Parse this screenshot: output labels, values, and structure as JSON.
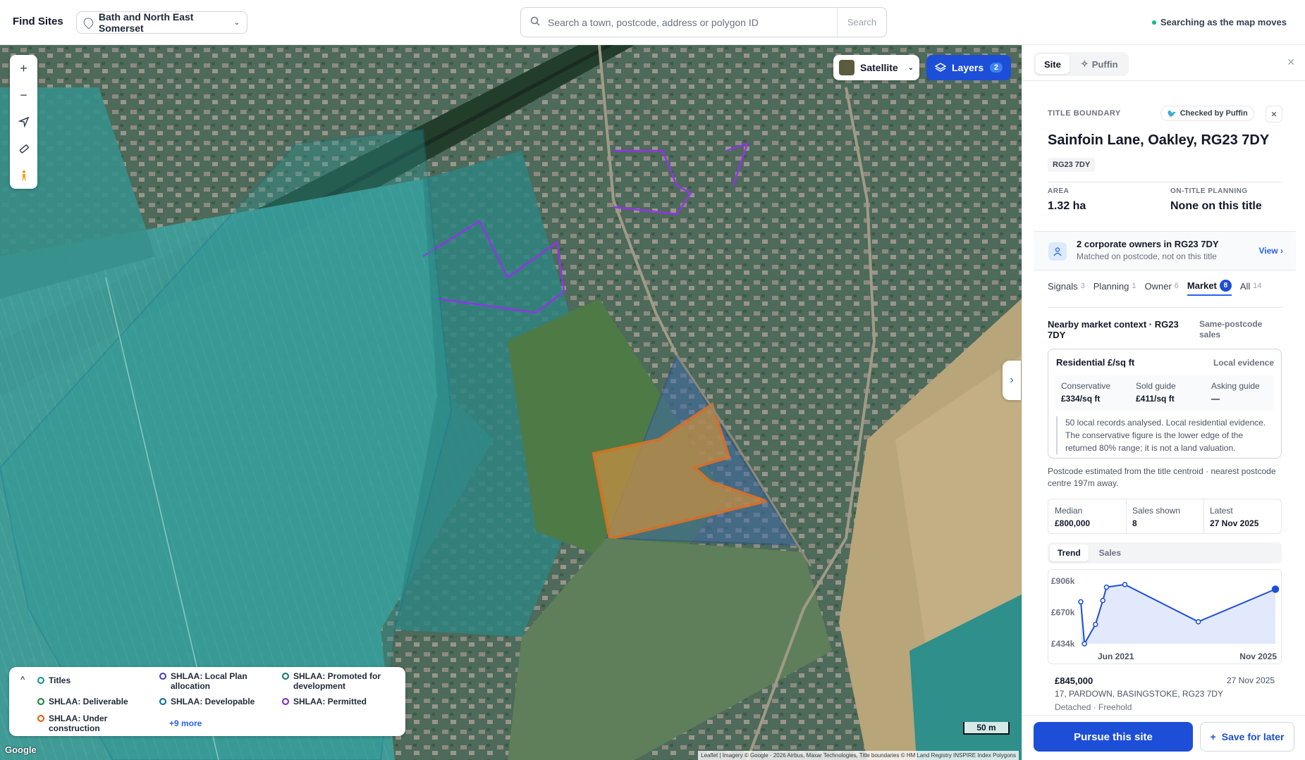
{
  "header": {
    "brand": "Find Sites",
    "region": "Bath and North East Somerset",
    "search_placeholder": "Search a town, postcode, address or polygon ID",
    "search_button": "Search",
    "status": "Searching as the map moves"
  },
  "map": {
    "basemap_label": "Satellite",
    "layers_label": "Layers",
    "layers_count": "2",
    "scale_label": "50 m",
    "provider": "Google",
    "attribution": "Leaflet | Imagery © Google · 2026 Airbus, Maxar Technologies, Title boundaries © HM Land Registry INSPIRE Index Polygons",
    "tools": [
      "zoom-in",
      "zoom-out",
      "locate",
      "measure",
      "street-view"
    ]
  },
  "legend": {
    "items": [
      {
        "label": "Titles",
        "color": "#0d9488"
      },
      {
        "label": "SHLAA: Local Plan allocation",
        "color": "#4338ca"
      },
      {
        "label": "SHLAA: Promoted for development",
        "color": "#0f766e"
      },
      {
        "label": "SHLAA: Deliverable",
        "color": "#15803d"
      },
      {
        "label": "SHLAA: Developable",
        "color": "#0369a1"
      },
      {
        "label": "SHLAA: Permitted",
        "color": "#7e22ce"
      },
      {
        "label": "SHLAA: Under construction",
        "color": "#ea580c"
      }
    ],
    "more": "+9 more"
  },
  "panel": {
    "tabs": [
      "Site",
      "Puffin"
    ],
    "section_label": "TITLE BOUNDARY",
    "checked_label": "Checked by Puffin",
    "title": "Sainfoin Lane, Oakley, RG23 7DY",
    "postcode_chip": "RG23 7DY",
    "area_label": "AREA",
    "area_value": "1.32 ha",
    "planning_label": "ON-TITLE PLANNING",
    "planning_value": "None on this title",
    "owners_title": "2 corporate owners in RG23 7DY",
    "owners_sub": "Matched on postcode, not on this title",
    "owners_view": "View",
    "signal_tabs": [
      {
        "label": "Signals",
        "count": "3"
      },
      {
        "label": "Planning",
        "count": "1"
      },
      {
        "label": "Owner",
        "count": "6"
      },
      {
        "label": "Market",
        "count": "8"
      },
      {
        "label": "All",
        "count": "14"
      }
    ],
    "market_title": "Nearby market context · RG23 7DY",
    "market_side": "Same-postcode sales",
    "res_title": "Residential £/sq ft",
    "res_badge": "Local evidence",
    "conservative_label": "Conservative",
    "conservative_value": "£334/sq ft",
    "sold_label": "Sold guide",
    "sold_value": "£411/sq ft",
    "asking_label": "Asking guide",
    "asking_value": "—",
    "res_note": "50 local records analysed. Local residential evidence. The conservative figure is the lower edge of the returned 80% range; it is not a land valuation.",
    "postcode_note": "Postcode estimated from the title centroid · nearest postcode centre 197m away.",
    "median_label": "Median",
    "median_value": "£800,000",
    "shown_label": "Sales shown",
    "shown_value": "8",
    "latest_label": "Latest",
    "latest_value": "27 Nov 2025",
    "chart_tabs": [
      "Trend",
      "Sales"
    ],
    "sale_price": "£845,000",
    "sale_date": "27 Nov 2025",
    "sale_addr": "17, PARDOWN, BASINGSTOKE, RG23 7DY",
    "sale_type": "Detached · Freehold",
    "pursue_label": "Pursue this site",
    "save_label": "Save for later"
  },
  "chart_data": {
    "type": "line",
    "y_ticks": [
      "£906k",
      "£670k",
      "£434k"
    ],
    "x_ticks": [
      "Jun 2021",
      "Nov 2025"
    ],
    "ylim": [
      434000,
      906000
    ],
    "xlim": [
      "2021-06",
      "2025-11"
    ],
    "x": [
      "2021-06",
      "2021-07",
      "2021-10",
      "2021-12",
      "2022-01",
      "2022-06",
      "2024-02",
      "2025-11"
    ],
    "values": [
      750000,
      434000,
      580000,
      760000,
      860000,
      880000,
      600000,
      845000
    ],
    "color": "#1d4ed8"
  }
}
